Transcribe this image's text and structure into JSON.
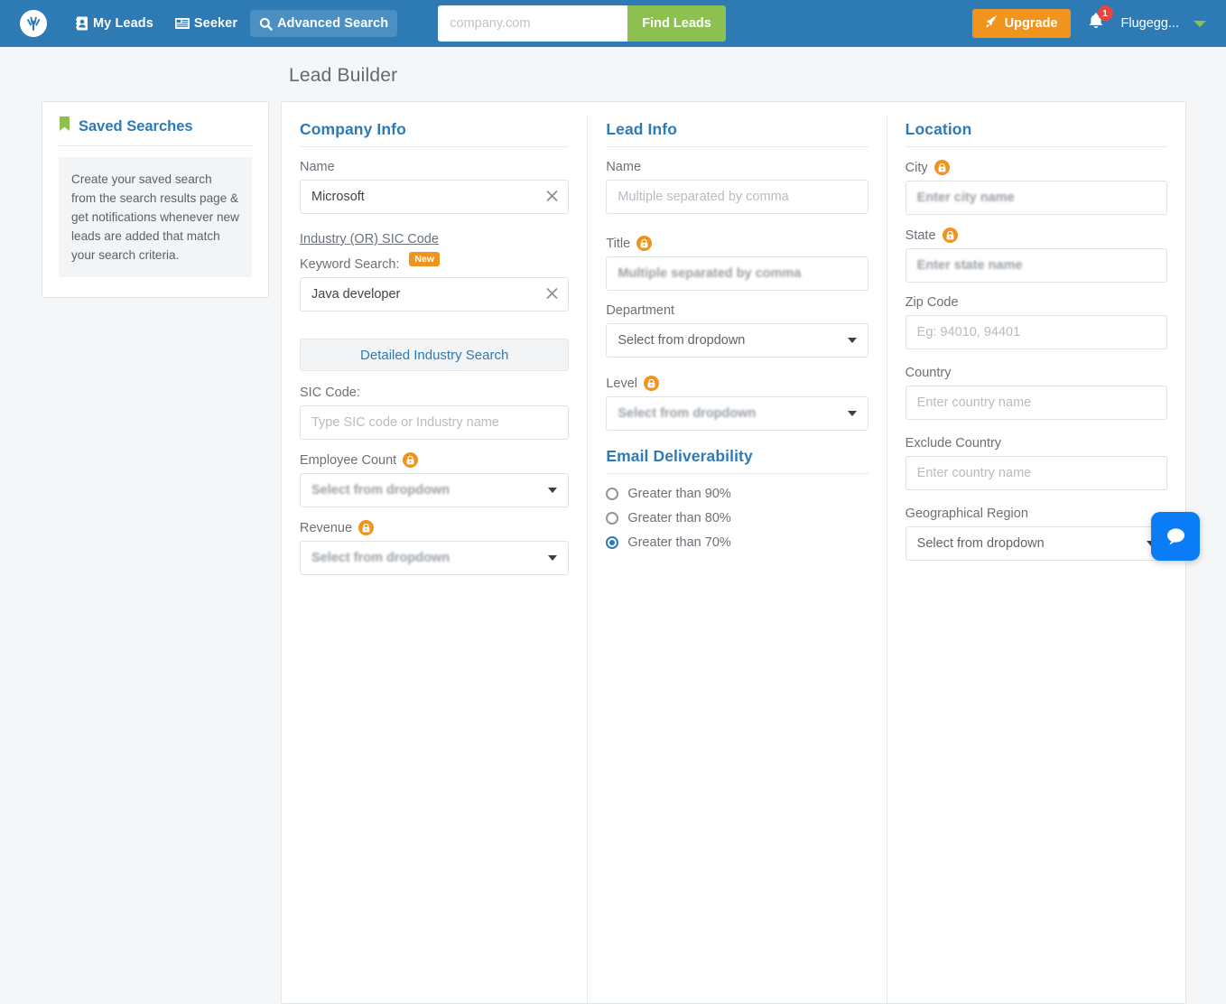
{
  "topnav": {
    "logo_icon": "leadiq-sprout-logo",
    "links": [
      {
        "label": "My Leads",
        "icon": "address-book-icon",
        "active": false
      },
      {
        "label": "Seeker",
        "icon": "list-cards-icon",
        "active": false
      },
      {
        "label": "Advanced Search",
        "icon": "search-icon",
        "active": true
      }
    ],
    "search": {
      "value": "",
      "placeholder": "company.com"
    },
    "find_leads_label": "Find Leads",
    "upgrade_label": "Upgrade",
    "upgrade_icon": "rocket-icon",
    "bell_icon": "bell-icon",
    "bell_count": "1",
    "user_name": "Flugegg...",
    "caret_icon": "chevron-down-icon",
    "bg_color": "#2e7ab5",
    "accent_green": "#8cc152",
    "accent_orange": "#f0941e"
  },
  "page": {
    "title": "Lead Builder"
  },
  "sidebar": {
    "icon": "bookmark-icon",
    "title": "Saved Searches",
    "body": "Create your saved search from the search results page & get notifications whenever new leads are added that match your search criteria."
  },
  "company_info": {
    "title": "Company Info",
    "name_label": "Name",
    "name_value": "Microsoft",
    "name_clear_icon": "close-icon",
    "industry_link": "Industry (OR) SIC Code",
    "keyword_label": "Keyword Search:",
    "keyword_badge": "New",
    "keyword_value": "Java developer",
    "keyword_clear_icon": "close-icon",
    "detailed_industry_label": "Detailed Industry Search",
    "sic_label": "SIC Code:",
    "sic_placeholder": "Type SIC code or Industry name",
    "employee_label": "Employee Count",
    "employee_locked": true,
    "employee_value": "Select from dropdown",
    "revenue_label": "Revenue",
    "revenue_locked": true,
    "revenue_value": "Select from dropdown"
  },
  "lead_info": {
    "title": "Lead Info",
    "name_label": "Name",
    "name_placeholder": "Multiple separated by comma",
    "title_label": "Title",
    "title_locked": true,
    "title_placeholder": "Multiple separated by comma",
    "department_label": "Department",
    "department_value": "Select from dropdown",
    "level_label": "Level",
    "level_locked": true,
    "level_value": "Select from dropdown",
    "email_title": "Email Deliverability",
    "email_options": [
      {
        "label": "Greater than 90%",
        "selected": false
      },
      {
        "label": "Greater than 80%",
        "selected": false
      },
      {
        "label": "Greater than 70%",
        "selected": true
      }
    ]
  },
  "location": {
    "title": "Location",
    "city_label": "City",
    "city_locked": true,
    "city_placeholder": "Enter city name",
    "state_label": "State",
    "state_locked": true,
    "state_placeholder": "Enter state name",
    "zip_label": "Zip Code",
    "zip_placeholder": "Eg: 94010, 94401",
    "country_label": "Country",
    "country_placeholder": "Enter country name",
    "exclude_country_label": "Exclude Country",
    "exclude_country_placeholder": "Enter country name",
    "region_label": "Geographical Region",
    "region_value": "Select from dropdown"
  },
  "chat": {
    "icon": "chat-bubble-icon",
    "color": "#0a7cf5"
  }
}
